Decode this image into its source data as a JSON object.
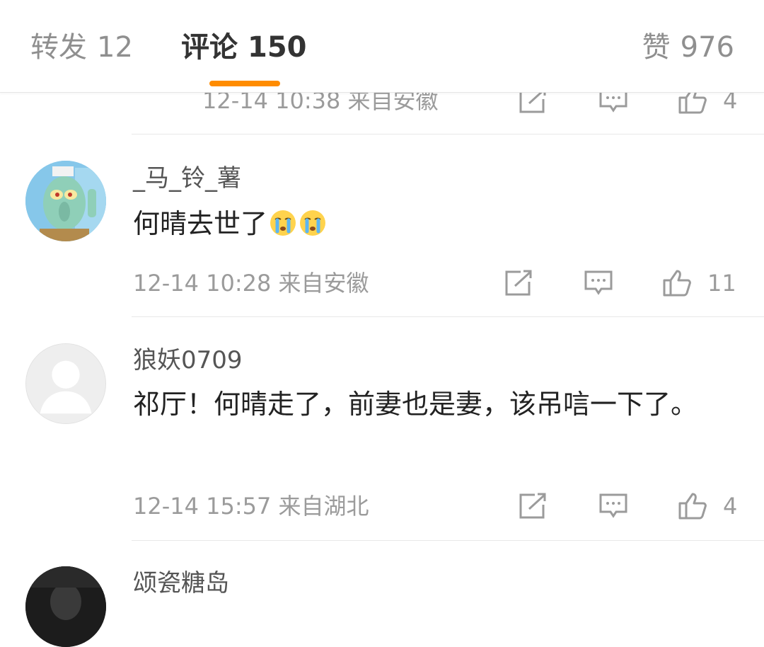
{
  "tabs": {
    "repost": {
      "label": "转发",
      "count": "12"
    },
    "comments": {
      "label": "评论",
      "count": "150"
    },
    "likes": {
      "label": "赞",
      "count": "976"
    }
  },
  "comments": [
    {
      "partial": true,
      "time": "12-14 10:38",
      "location": "来自安徽",
      "meta": "12-14 10:38 来自安徽",
      "likes": "4"
    },
    {
      "username": "_马_铃_薯",
      "text": "何晴去世了",
      "emojis": [
        "crying-emoji",
        "crying-emoji"
      ],
      "meta": "12-14 10:28 来自安徽",
      "likes": "11"
    },
    {
      "username": "狼妖0709",
      "text": "祁厅！何晴走了，前妻也是妻，该吊唁一下了。",
      "meta": "12-14 15:57 来自湖北",
      "likes": "4"
    },
    {
      "username": "颂瓷糖岛",
      "partial": true
    }
  ],
  "icons": {
    "share": "share-icon",
    "reply": "comment-icon",
    "like": "thumbs-up-icon"
  },
  "colors": {
    "accent": "#ff8c00",
    "muted": "#9b9b9b"
  }
}
